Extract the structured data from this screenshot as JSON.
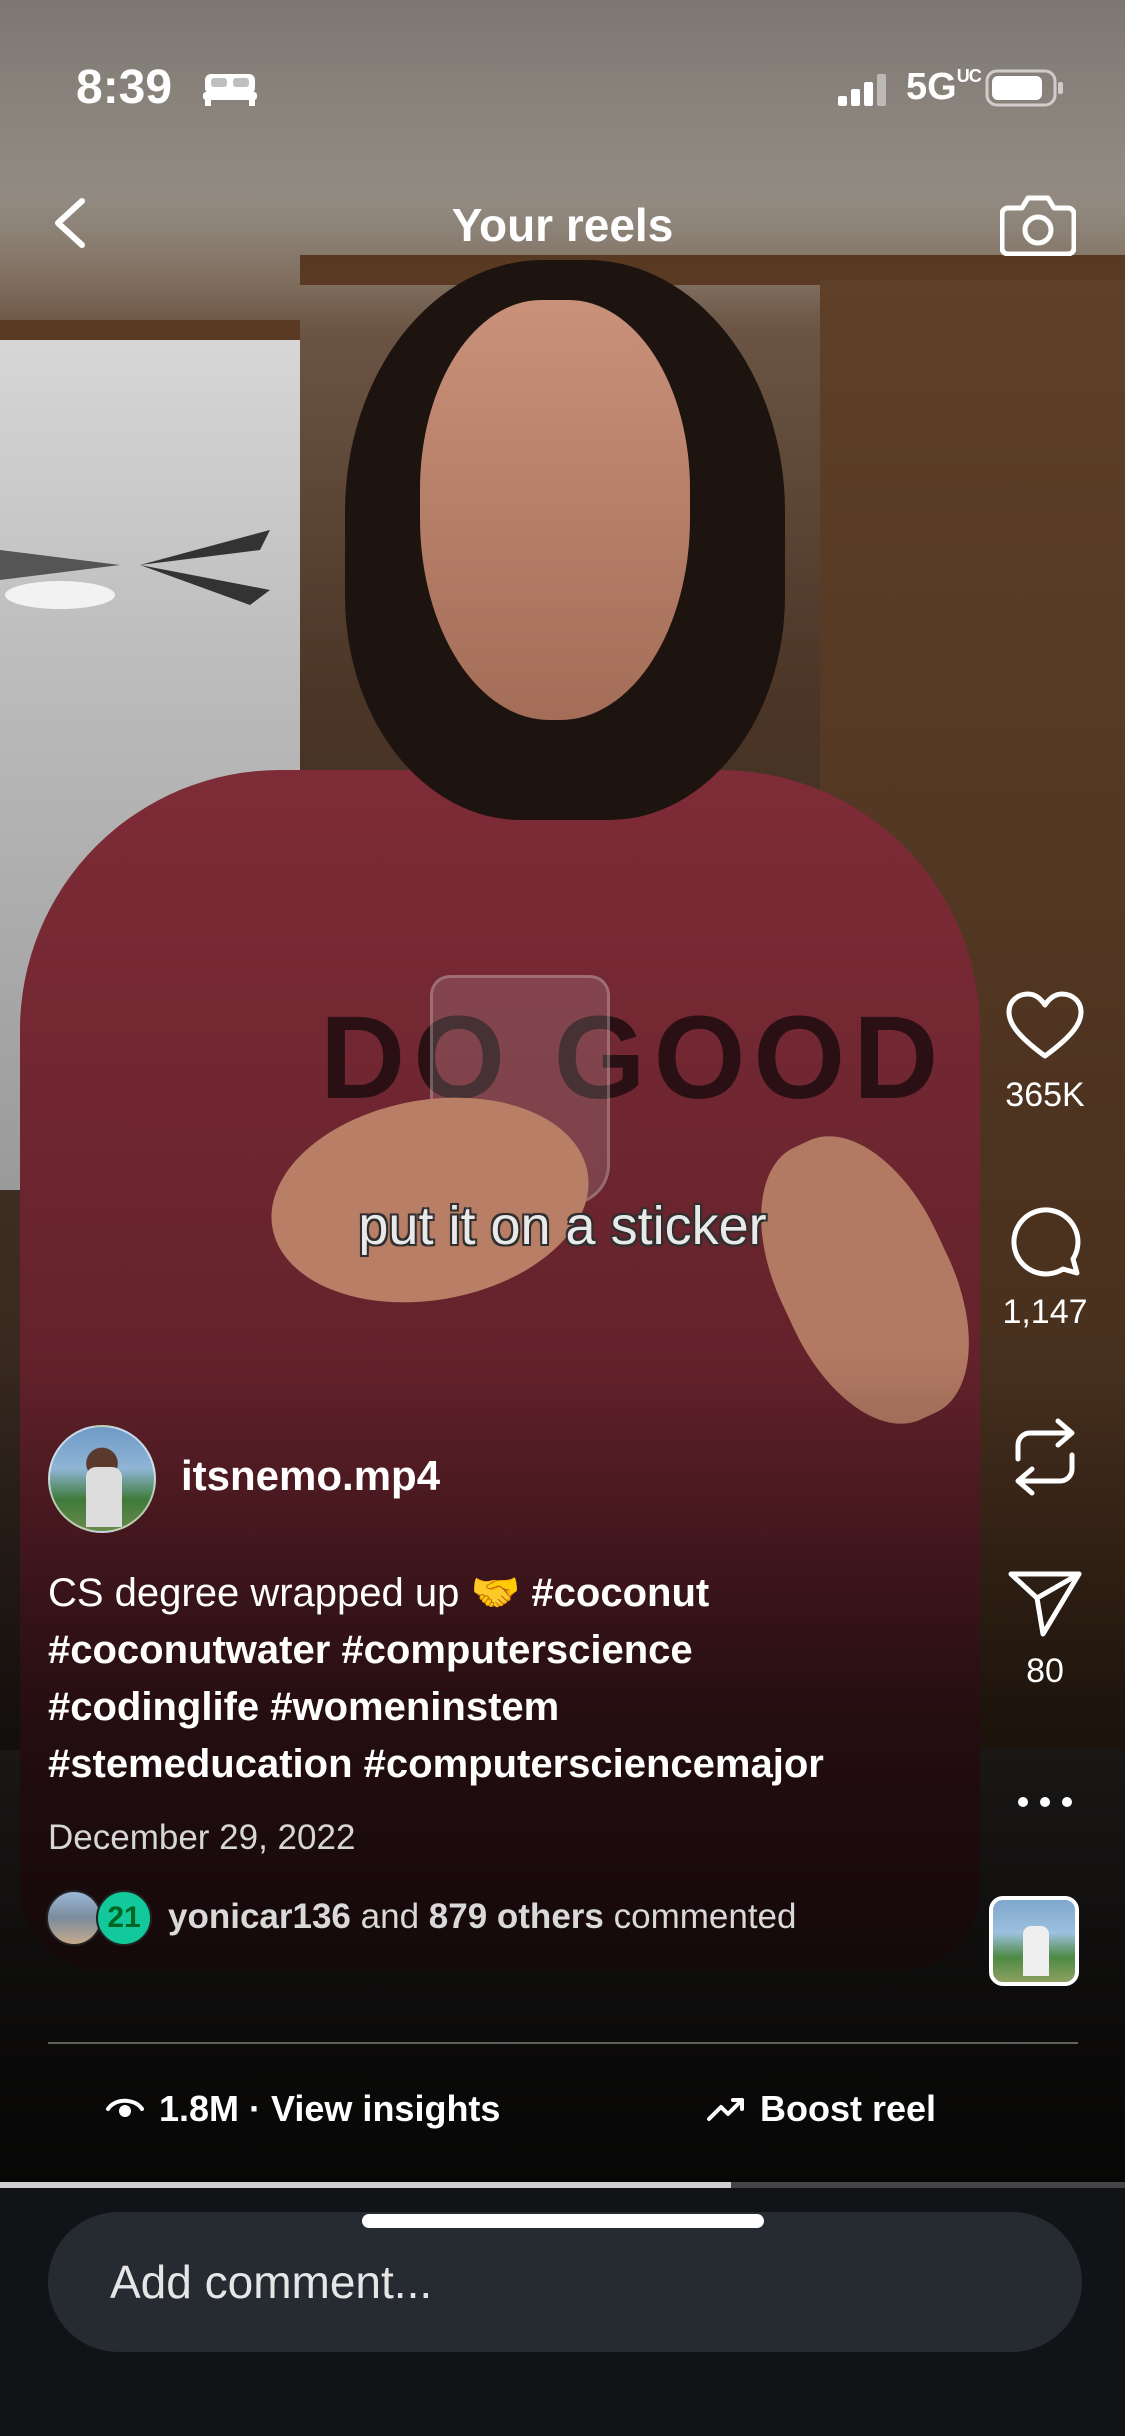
{
  "status_bar": {
    "time": "8:39",
    "network": "5G",
    "network_suffix": "UC"
  },
  "nav": {
    "title": "Your reels"
  },
  "video": {
    "sticker_caption": "put it on a sticker",
    "shirt_text": "DO GOOD",
    "progress_fraction": 0.65
  },
  "actions": {
    "likes": "365K",
    "comments": "1,147",
    "shares": "80"
  },
  "post": {
    "username": "itsnemo.mp4",
    "caption_lines": [
      {
        "plain": "CS degree wrapped up 🤝 ",
        "tags": "#coconut"
      },
      {
        "plain": "",
        "tags": "#coconutwater #computerscience"
      },
      {
        "plain": "",
        "tags": "#codinglife #womeninstem"
      },
      {
        "plain": "",
        "tags": "#stemeducation #computersciencemajor"
      }
    ],
    "date": "December 29, 2022",
    "commenters": {
      "first": "yonicar136",
      "connector": "and",
      "others": "879 others",
      "suffix": "commented",
      "badge": "21"
    }
  },
  "footer": {
    "views": "1.8M",
    "separator": "·",
    "insights_label": "View insights",
    "boost_label": "Boost reel",
    "comment_placeholder": "Add comment..."
  },
  "icons": [
    "bed-icon",
    "signal-icon",
    "battery-icon",
    "back-chevron-icon",
    "camera-icon",
    "heart-icon",
    "comment-bubble-icon",
    "remix-icon",
    "send-icon",
    "more-icon",
    "eye-icon",
    "trending-icon"
  ]
}
